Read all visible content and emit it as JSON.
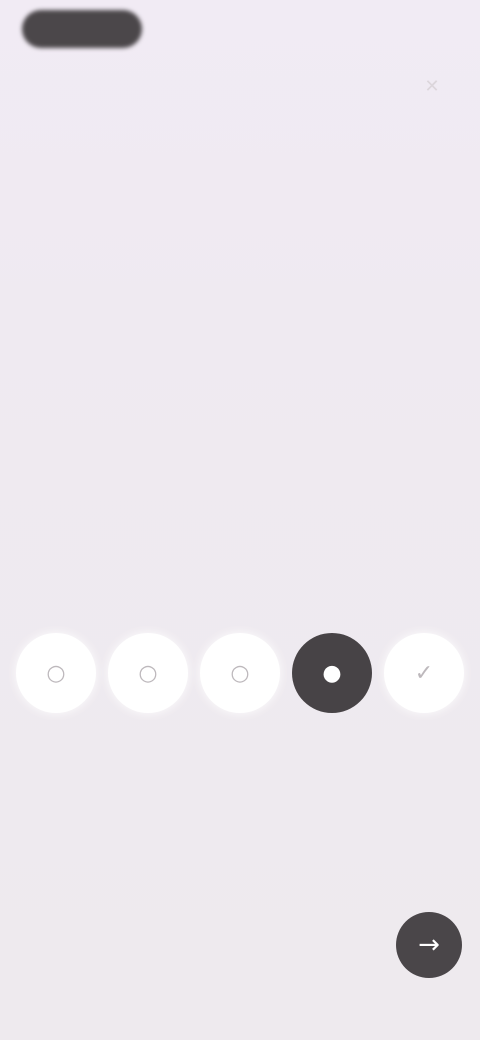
{
  "status": {
    "pill_label": ""
  },
  "top_bar": {
    "action_icon": "close-icon"
  },
  "question": {
    "text": ""
  },
  "options": {
    "items": [
      {
        "label": "",
        "icon": "circle-icon",
        "selected": false
      },
      {
        "label": "",
        "icon": "circle-icon",
        "selected": false
      },
      {
        "label": "",
        "icon": "circle-icon",
        "selected": false
      },
      {
        "label": "",
        "icon": "circle-icon",
        "selected": true
      },
      {
        "label": "",
        "icon": "check-icon",
        "selected": false
      }
    ]
  },
  "navigation": {
    "next_icon": "arrow-right-icon"
  },
  "colors": {
    "background": "#efeaf0",
    "accent": "#474346",
    "option_bg": "#ffffff"
  }
}
